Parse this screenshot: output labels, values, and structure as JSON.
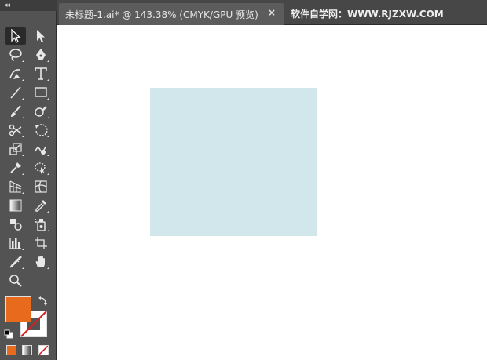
{
  "document_tab": {
    "title": "未标题-1.ai* @ 143.38% (CMYK/GPU 预览)",
    "close_glyph": "×"
  },
  "watermark_text": "软件自学网：WWW.RJZXW.COM",
  "toolbar": {
    "collapse_glyph": "◂◂",
    "tools": [
      "selection-tool",
      "direct-selection-tool",
      "lasso-tool",
      "pen-tool",
      "curvature-tool",
      "type-tool",
      "line-segment-tool",
      "rectangle-tool",
      "paintbrush-tool",
      "shaper-tool",
      "scissors-tool",
      "rotate-tool",
      "scale-tool",
      "warp-tool",
      "puppet-warp-tool",
      "free-transform-tool",
      "perspective-grid-tool",
      "mesh-tool",
      "gradient-tool",
      "eyedropper-tool",
      "blend-tool",
      "symbol-sprayer-tool",
      "column-graph-tool",
      "artboard-tool",
      "slice-tool",
      "hand-tool",
      "zoom-tool"
    ]
  },
  "colors": {
    "fill": "#e86a1d",
    "stroke": "none",
    "rectangle_fill": "#d2e7ec",
    "none_slash": "#d62020"
  }
}
